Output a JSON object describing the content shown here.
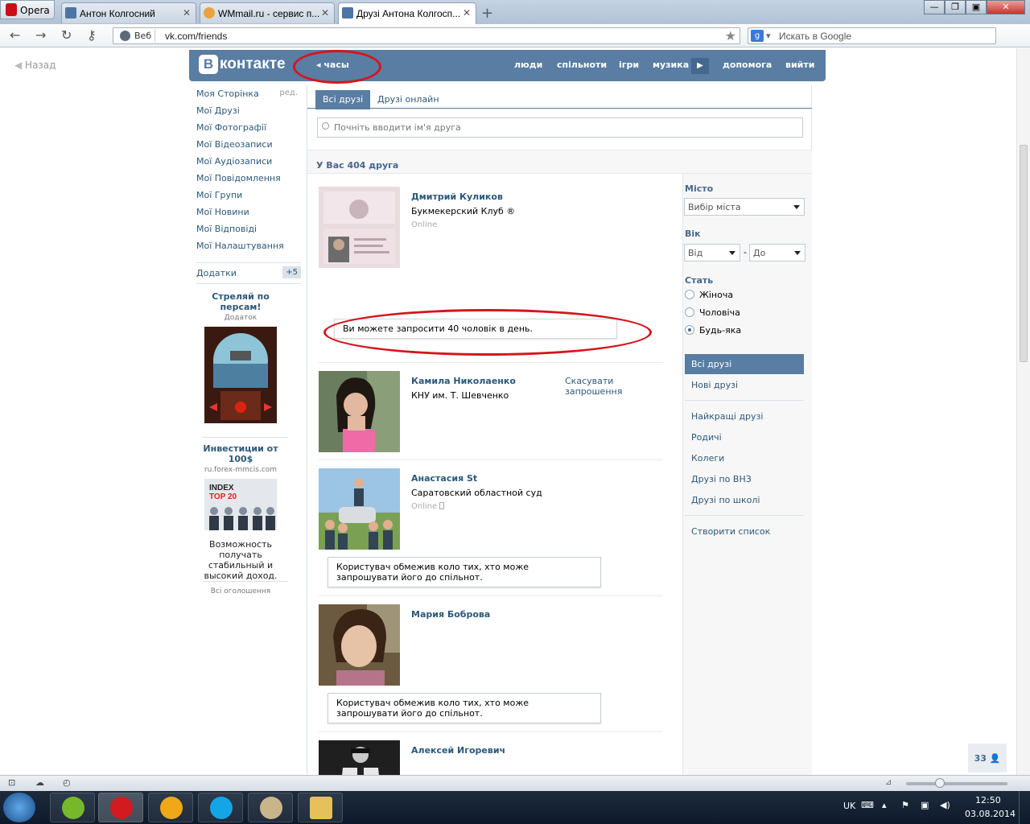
{
  "browser": {
    "menu_label": "Opera",
    "tabs": [
      {
        "label": "Антон Колгосний"
      },
      {
        "label": "WMmail.ru - сервис п..."
      },
      {
        "label": "Друзі Антона Колгосп..."
      }
    ],
    "address": {
      "web_label": "Веб",
      "url": "vk.com/friends"
    },
    "search": {
      "placeholder": "Искать в Google",
      "engine_icon": "google-icon"
    }
  },
  "page": {
    "back_label": "Назад",
    "header": {
      "logo_text": "контакте",
      "logo_letter": "В",
      "audio_label": "часы",
      "nav": [
        "люди",
        "спільноти",
        "ігри",
        "музика",
        "допомога",
        "вийти"
      ]
    },
    "left_menu": {
      "items": [
        "Моя Сторінка",
        "Мої Друзі",
        "Мої Фотографії",
        "Мої Відеозаписи",
        "Мої Аудіозаписи",
        "Мої Повідомлення",
        "Мої Групи",
        "Мої Новини",
        "Мої Відповіді",
        "Мої Налаштування"
      ],
      "edit_label": "ред.",
      "apps_label": "Додатки",
      "apps_count": "+5"
    },
    "ads": [
      {
        "title": "Стреляй по персам!",
        "subtitle": "Додаток"
      },
      {
        "title": "Инвестиции от 100$",
        "subtitle": "ru.forex-mmcis.com",
        "image_text_1": "INDEX",
        "image_text_2": "TOP 20",
        "description": "Возможность получать стабильный и высокий доход."
      }
    ],
    "ads_all_label": "Всі оголошення",
    "friends": {
      "tabs": [
        "Всі друзі",
        "Друзі онлайн"
      ],
      "search_placeholder": "Почніть вводити ім'я друга",
      "count_label": "У Вас 404 друга",
      "list": [
        {
          "name": "Дмитрий Куликов",
          "info": "Букмекерский Клуб ®",
          "status": "Online",
          "note": "Ви можете запросити 40 чоловік в день."
        },
        {
          "name": "Камила Николаенко",
          "info": "КНУ им. Т. Шевченко",
          "action": "Скасувати запрошення"
        },
        {
          "name": "Анастасия St",
          "info": "Саратовский областной суд",
          "status": "Online",
          "note": "Користувач обмежив коло тих, хто може запрошувати його до спільнот."
        },
        {
          "name": "Мария Боброва",
          "note": "Користувач обмежив коло тих, хто може запрошувати його до спільнот."
        },
        {
          "name": "Алексей Игоревич"
        }
      ]
    },
    "filter": {
      "city_label": "Місто",
      "city_value": "Вибір міста",
      "age_label": "Вік",
      "age_from": "Від",
      "age_to": "До",
      "age_dash": "-",
      "sex_label": "Стать",
      "sex_options": [
        "Жіноча",
        "Чоловіча",
        "Будь-яка"
      ],
      "sex_selected": "Будь-яка",
      "menu": [
        "Всі друзі",
        "Нові друзі",
        "Найкращі друзі",
        "Родичі",
        "Колеги",
        "Друзі по ВНЗ",
        "Друзі по школі",
        "Створити список"
      ]
    },
    "chat_count": "33"
  },
  "system": {
    "lang": "UK",
    "time": "12:50",
    "date": "03.08.2014"
  },
  "colors": {
    "vk_blue": "#597da3",
    "link": "#2b587a",
    "annotation_red": "#d4161d"
  }
}
